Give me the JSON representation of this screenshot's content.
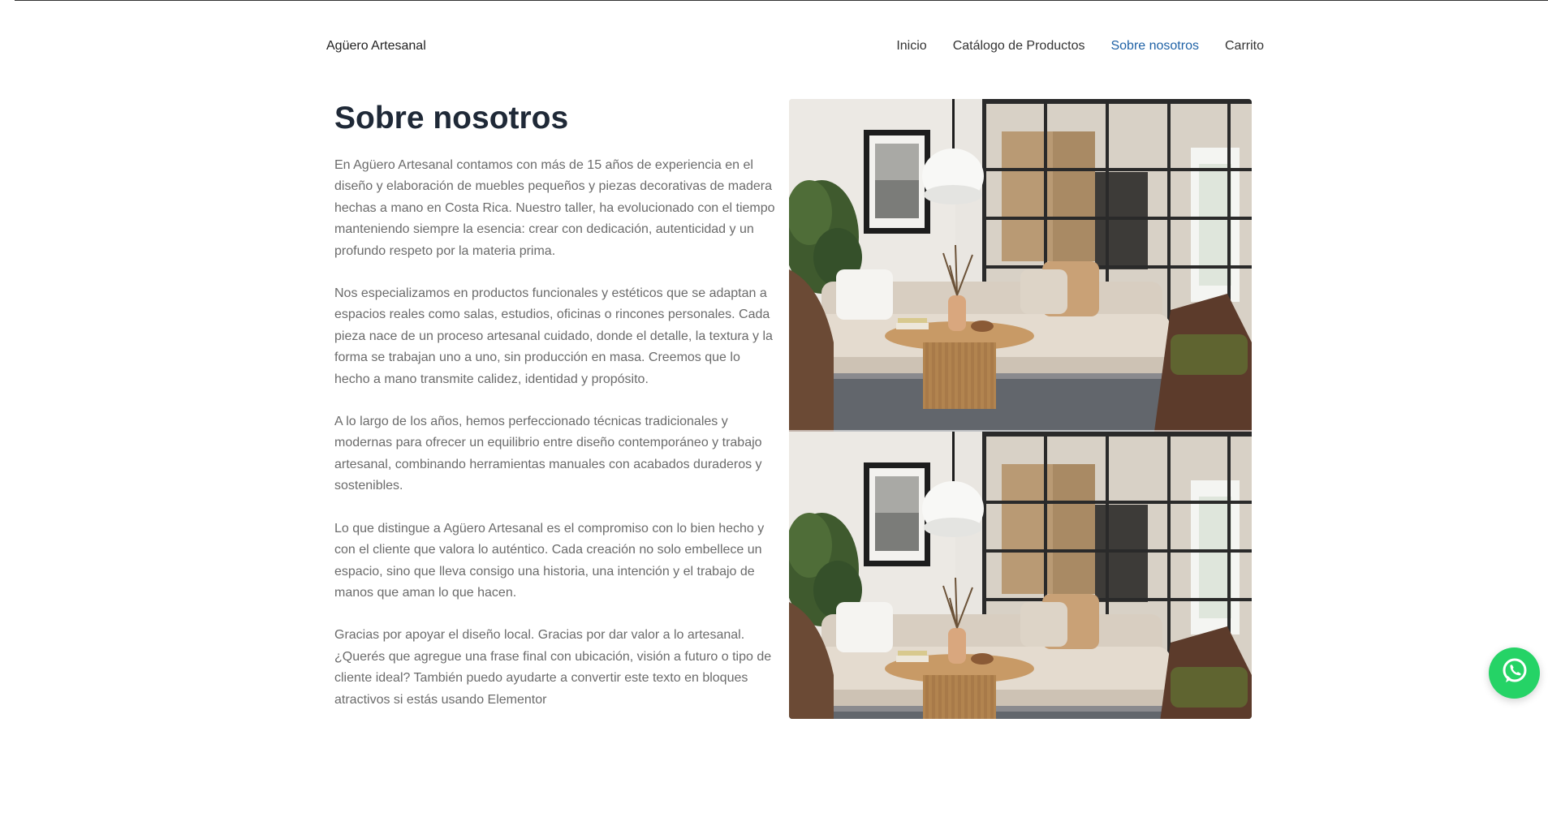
{
  "header": {
    "brand": "Agüero Artesanal",
    "nav": [
      {
        "label": "Inicio",
        "active": false
      },
      {
        "label": "Catálogo de Productos",
        "active": false
      },
      {
        "label": "Sobre nosotros",
        "active": true
      },
      {
        "label": "Carrito",
        "active": false
      }
    ]
  },
  "about": {
    "title": "Sobre nosotros",
    "paragraphs": [
      "En Agüero Artesanal contamos con más de 15 años de experiencia en el diseño y elaboración de muebles pequeños y piezas decorativas de madera hechas a mano en Costa Rica. Nuestro taller, ha evolucionado con el tiempo manteniendo siempre la esencia: crear con dedicación, autenticidad y un profundo respeto por la materia prima.",
      "Nos especializamos en productos funcionales y estéticos que se adaptan a espacios reales como salas, estudios, oficinas o rincones personales. Cada pieza nace de un proceso artesanal cuidado, donde el detalle, la textura y la forma se trabajan uno a uno, sin producción en masa. Creemos que lo hecho a mano transmite calidez, identidad y propósito.",
      "A lo largo de los años, hemos perfeccionado técnicas tradicionales y modernas para ofrecer un equilibrio entre diseño contemporáneo y trabajo artesanal, combinando herramientas manuales con acabados duraderos y sostenibles.",
      "Lo que distingue a Agüero Artesanal es el compromiso con lo bien hecho y con el cliente que valora lo auténtico. Cada creación no solo embellece un espacio, sino que lleva consigo una historia, una intención y el trabajo de manos que aman lo que hacen.",
      "Gracias por apoyar el diseño local. Gracias por dar valor a lo artesanal. ¿Querés que agregue una frase final con ubicación, visión a futuro o tipo de cliente ideal? También puedo ayudarte a convertir este texto en bloques atractivos si estás usando Elementor"
    ]
  },
  "images": [
    {
      "name": "living-room-photo"
    },
    {
      "name": "living-room-photo"
    }
  ],
  "whatsapp": {
    "icon": "whatsapp-icon",
    "color": "#25d366"
  },
  "colors": {
    "nav_active": "#1f62a6",
    "title": "#1f2937",
    "body_text": "#6b6b6b"
  }
}
